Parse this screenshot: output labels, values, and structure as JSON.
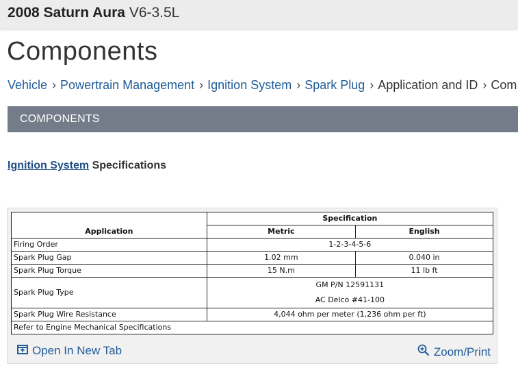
{
  "header": {
    "vehicle_bold": "2008 Saturn Aura",
    "vehicle_engine": "V6-3.5L"
  },
  "page_title": "Components",
  "breadcrumb": {
    "items": [
      "Vehicle",
      "Powertrain Management",
      "Ignition System",
      "Spark Plug"
    ],
    "current": "Application and ID",
    "trailing": "Com"
  },
  "section_bar": {
    "label": "COMPONENTS"
  },
  "spec_heading": {
    "link": "Ignition System",
    "rest": "Specifications"
  },
  "table": {
    "headers": {
      "application": "Application",
      "specification": "Specification",
      "metric": "Metric",
      "english": "English"
    },
    "rows": [
      {
        "application": "Firing Order",
        "combined": "1-2-3-4-5-6"
      },
      {
        "application": "Spark Plug Gap",
        "metric": "1.02 mm",
        "english": "0.040 in"
      },
      {
        "application": "Spark Plug Torque",
        "metric": "15 N.m",
        "english": "11 lb ft"
      },
      {
        "application": "Spark Plug Type",
        "combined_line1": "GM P/N 12591131",
        "combined_line2": "AC Delco #41-100"
      },
      {
        "application": "Spark Plug Wire Resistance",
        "combined": "4,044 ohm per meter (1,236 ohm per ft)"
      },
      {
        "application": "Refer to Engine Mechanical Specifications"
      }
    ]
  },
  "actions": {
    "open_tab": "Open In New Tab",
    "zoom": "Zoom/Print"
  },
  "colors": {
    "link": "#1f5c99",
    "section_bar": "#737c88",
    "topbar": "#ececec"
  }
}
